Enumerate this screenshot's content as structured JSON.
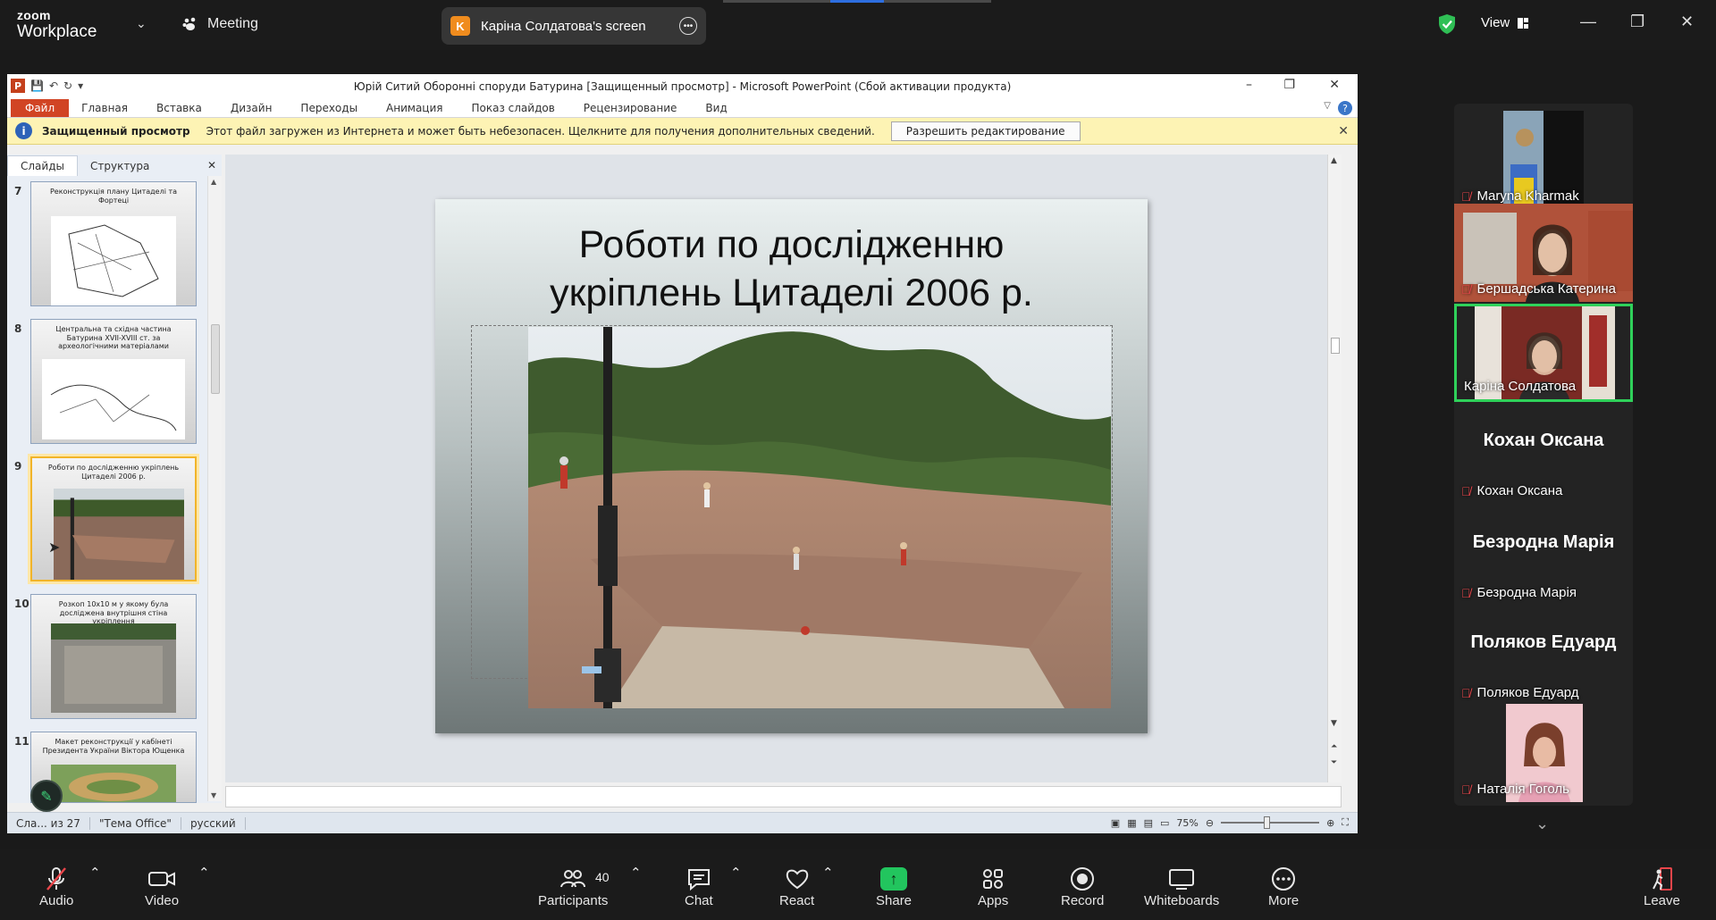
{
  "zoom": {
    "brand_small": "zoom",
    "brand": "Workplace",
    "meeting_label": "Meeting",
    "share_badge_letter": "K",
    "share_label": "Каріна Солдатова's screen",
    "view_label": "View"
  },
  "ppt": {
    "window_title": "Юрій Ситий Оборонні споруди Батурина [Защищенный просмотр] - Microsoft PowerPoint (Сбой активации продукта)",
    "ribbon_file": "Файл",
    "ribbon_tabs": [
      "Главная",
      "Вставка",
      "Дизайн",
      "Переходы",
      "Анимация",
      "Показ слайдов",
      "Рецензирование",
      "Вид"
    ],
    "protected_bold": "Защищенный просмотр",
    "protected_msg": "Этот файл загружен из Интернета и может быть небезопасен. Щелкните для получения дополнительных сведений.",
    "protected_button": "Разрешить редактирование",
    "panel_tabs": [
      "Слайды",
      "Структура"
    ],
    "thumbnails": [
      {
        "num": "7",
        "title": "Реконструкція плану Цитаделі та Фортеці"
      },
      {
        "num": "8",
        "title": "Центральна та східна частина Батурина XVII-XVIII ст. за археологічними матеріалами"
      },
      {
        "num": "9",
        "title": "Роботи по дослідженню укріплень Цитаделі 2006 р."
      },
      {
        "num": "10",
        "title": "Розкоп 10х10 м у якому була досліджена внутрішня стіна укріплення"
      },
      {
        "num": "11",
        "title": "Макет реконструкції у кабінеті Президента України Віктора Ющенка"
      }
    ],
    "slide_title_line1": "Роботи по дослідженню",
    "slide_title_line2": "укріплень Цитаделі 2006 р.",
    "status_slide": "Сла... из 27",
    "status_theme": "\"Тема Office\"",
    "status_lang": "русский",
    "zoom_level": "75%"
  },
  "participants": [
    {
      "name": "Maryna Kharmak",
      "video": true,
      "active": false
    },
    {
      "name": "Бершадська Катерина",
      "video": true,
      "active": false
    },
    {
      "name": "Каріна Солдатова",
      "video": true,
      "active": true
    },
    {
      "name": "Кохан Оксана",
      "big": "Кохан Оксана",
      "video": false
    },
    {
      "name": "Безродна Марія",
      "big": "Безродна Марія",
      "video": false
    },
    {
      "name": "Поляков Едуард",
      "big": "Поляков Едуард",
      "video": false
    },
    {
      "name": "Наталія Гоголь",
      "video": true,
      "active": false
    }
  ],
  "toolbar": {
    "audio": "Audio",
    "video": "Video",
    "participants": "Participants",
    "participant_count": "40",
    "chat": "Chat",
    "react": "React",
    "share": "Share",
    "apps": "Apps",
    "record": "Record",
    "whiteboards": "Whiteboards",
    "more": "More",
    "leave": "Leave"
  },
  "colors": {
    "share_green": "#22c55e",
    "active_border": "#2fd15a",
    "muted_red": "#e9454a",
    "ppt_orange": "#d14424"
  }
}
